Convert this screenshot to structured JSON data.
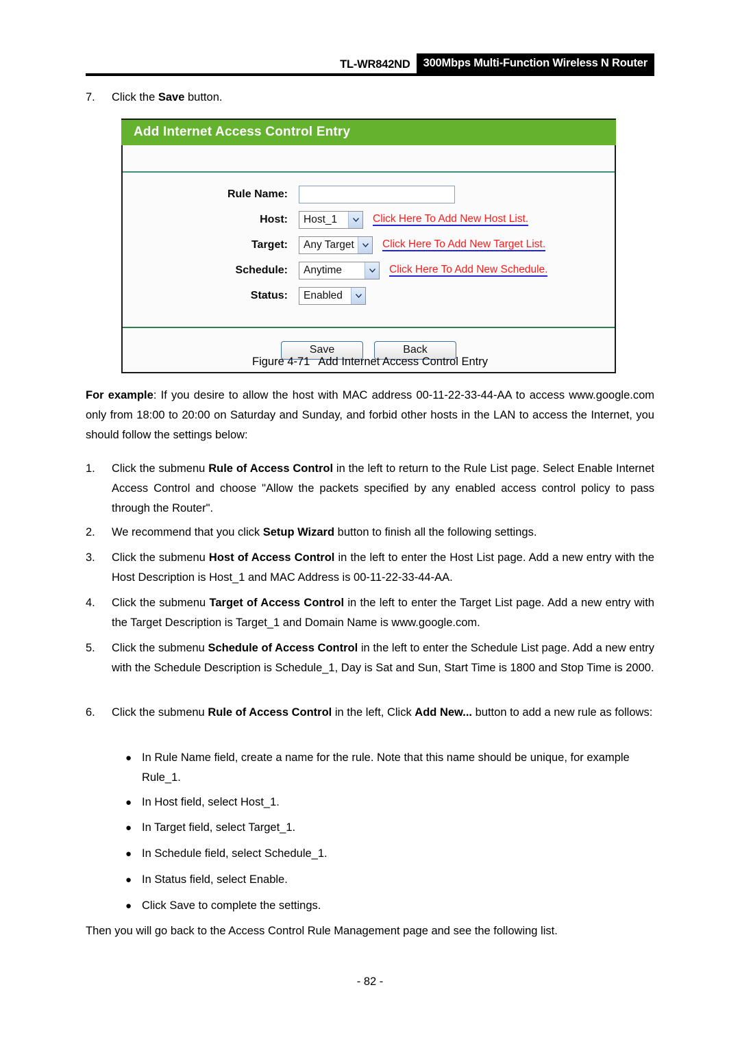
{
  "header": {
    "model": "TL-WR842ND",
    "description": "300Mbps Multi-Function Wireless N Router"
  },
  "step7": {
    "number": "7.",
    "text_before": "Click the ",
    "bold": "Save",
    "text_after": " button."
  },
  "panel": {
    "title": "Add Internet Access Control Entry",
    "fields": {
      "rule_name_label": "Rule Name:",
      "rule_name_value": "",
      "host_label": "Host:",
      "host_value": "Host_1",
      "host_link": "Click Here To Add New Host List.",
      "target_label": "Target:",
      "target_value": "Any Target",
      "target_link": "Click Here To Add New Target List.",
      "schedule_label": "Schedule:",
      "schedule_value": "Anytime",
      "schedule_link": "Click Here To Add New Schedule.",
      "status_label": "Status:",
      "status_value": "Enabled"
    },
    "buttons": {
      "save": "Save",
      "back": "Back"
    }
  },
  "figure": {
    "number": "Figure 4-71",
    "title": "Add Internet Access Control Entry"
  },
  "example": {
    "lead": "For example",
    "rest": ": If you desire to allow the host with MAC address 00-11-22-33-44-AA to access www.google.com only from 18:00 to 20:00 on Saturday and Sunday, and forbid other hosts in the LAN to access the Internet, you should follow the settings below:"
  },
  "steps": [
    {
      "number": "1.",
      "parts": [
        {
          "t": "Click the submenu ",
          "b": false
        },
        {
          "t": "Rule of Access Control",
          "b": true
        },
        {
          "t": " in the left to return to the Rule List page. Select Enable Internet Access Control and choose \"Allow the packets specified by any enabled access control policy to pass through the Router\".",
          "b": false
        }
      ]
    },
    {
      "number": "2.",
      "parts": [
        {
          "t": "We recommend that you click ",
          "b": false
        },
        {
          "t": "Setup Wizard",
          "b": true
        },
        {
          "t": " button to finish all the following settings.",
          "b": false
        }
      ]
    },
    {
      "number": "3.",
      "parts": [
        {
          "t": "Click the submenu ",
          "b": false
        },
        {
          "t": "Host of Access Control",
          "b": true
        },
        {
          "t": " in the left to enter the Host List page. Add a new entry with the Host Description is Host_1 and MAC Address is 00-11-22-33-44-AA.",
          "b": false
        }
      ]
    },
    {
      "number": "4.",
      "parts": [
        {
          "t": "Click the submenu ",
          "b": false
        },
        {
          "t": "Target of Access Control",
          "b": true
        },
        {
          "t": " in the left to enter the Target List page. Add a new entry with the Target Description is Target_1 and Domain Name is www.google.com.",
          "b": false
        }
      ]
    },
    {
      "number": "5.",
      "parts": [
        {
          "t": "Click the submenu ",
          "b": false
        },
        {
          "t": "Schedule of Access Control",
          "b": true
        },
        {
          "t": " in the left to enter the Schedule List page. Add a new entry with the Schedule Description is Schedule_1, Day is Sat and Sun, Start Time is 1800 and Stop Time is 2000.",
          "b": false
        }
      ]
    },
    {
      "number": "6.",
      "parts": [
        {
          "t": "Click the submenu ",
          "b": false
        },
        {
          "t": "Rule of Access Control",
          "b": true
        },
        {
          "t": " in the left, Click ",
          "b": false
        },
        {
          "t": "Add New...",
          "b": true
        },
        {
          "t": " button to add a new rule as follows:",
          "b": false
        }
      ]
    }
  ],
  "bullets": [
    "In Rule Name field, create a name for the rule. Note that this name should be unique, for example Rule_1.",
    "In Host field, select Host_1.",
    "In Target field, select Target_1.",
    "In Schedule field, select Schedule_1.",
    "In Status field, select Enable.",
    "Click Save to complete the settings."
  ],
  "closing": "Then you will go back to the Access Control Rule Management page and see the following list.",
  "page_number": "- 82 -",
  "colors": {
    "panel_header_green": "#64b22e",
    "link_red": "#fb1c1c",
    "link_underline_blue": "#2222dd",
    "divider_green": "#2f7d4e",
    "header_black": "#000000"
  }
}
